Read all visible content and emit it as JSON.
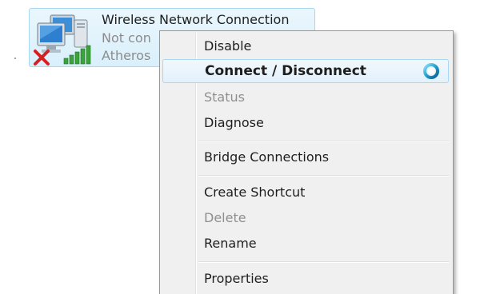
{
  "connection": {
    "name": "Wireless Network Connection",
    "status": "Not con",
    "device": "Atheros",
    "icon": "wireless-network-icon",
    "disconnected_icon": "red-x-icon",
    "signal_icon": "signal-bars-icon"
  },
  "context_menu": {
    "items": [
      {
        "label": "Disable",
        "state": "normal"
      },
      {
        "label": "Connect / Disconnect",
        "state": "default-hover",
        "icon": "busy-spinner-icon"
      },
      {
        "label": "Status",
        "state": "disabled"
      },
      {
        "label": "Diagnose",
        "state": "normal"
      },
      {
        "label": "Bridge Connections",
        "state": "normal"
      },
      {
        "label": "Create Shortcut",
        "state": "normal"
      },
      {
        "label": "Delete",
        "state": "disabled"
      },
      {
        "label": "Rename",
        "state": "normal"
      },
      {
        "label": "Properties",
        "state": "normal"
      }
    ]
  },
  "colors": {
    "tile_border": "#a8d8f0",
    "hover_border": "#a9d6f1",
    "disabled_text": "#8f8f8f",
    "signal_green": "#3aa43a",
    "x_red": "#d42020"
  }
}
